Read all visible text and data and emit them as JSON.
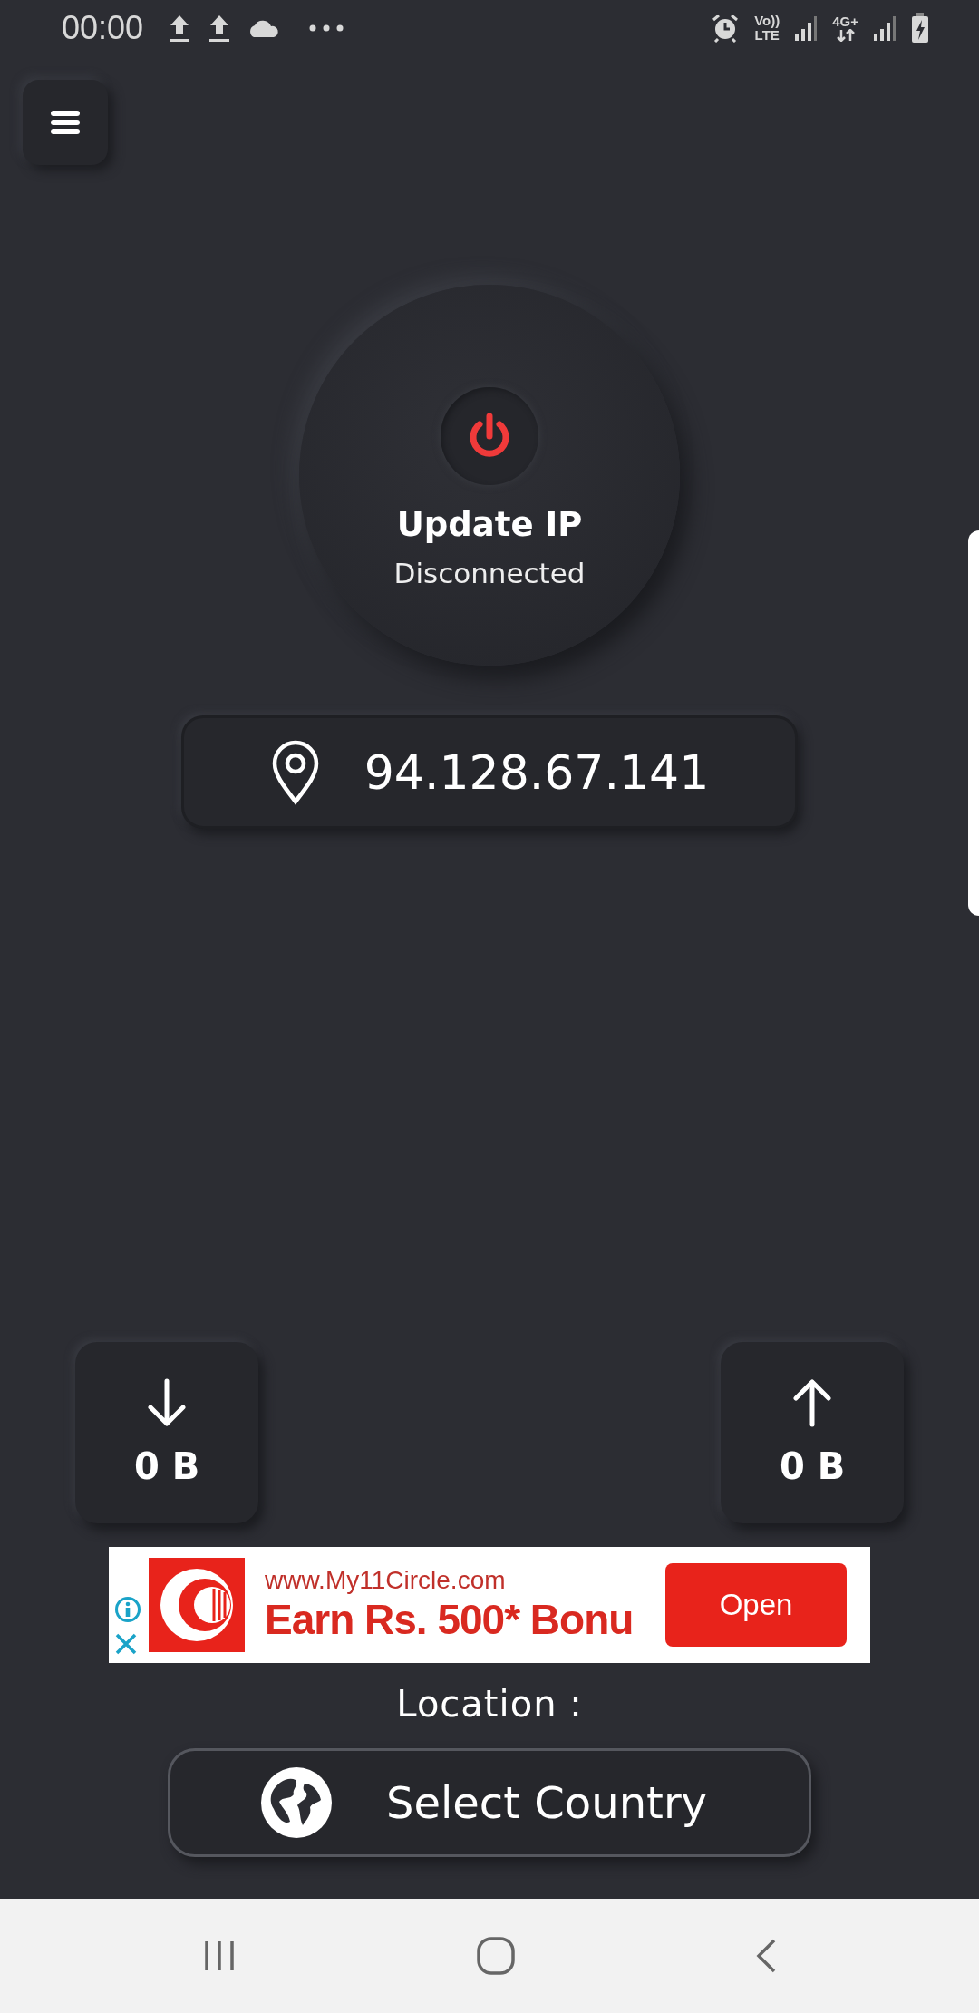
{
  "status_bar": {
    "time": "00:00",
    "volte_top": "Vo))",
    "volte_bottom": "LTE",
    "network_type": "4G+"
  },
  "power_button": {
    "title": "Update IP",
    "status": "Disconnected"
  },
  "ip_address": "94.128.67.141",
  "download": {
    "value": "0 B"
  },
  "upload": {
    "value": "0 B"
  },
  "ad": {
    "url": "www.My11Circle.com",
    "headline": "Earn Rs. 500* Bonu",
    "button": "Open"
  },
  "location_label": "Location :",
  "select_country": "Select Country"
}
